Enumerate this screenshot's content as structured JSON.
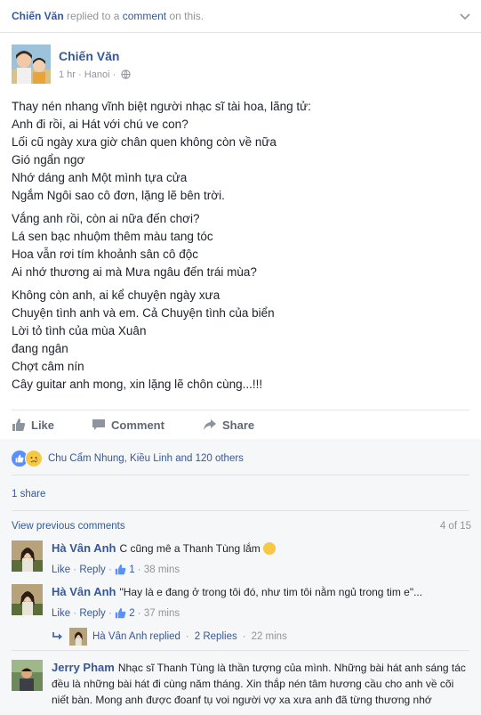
{
  "story": {
    "actor": "Chiến Văn",
    "action": "replied to a",
    "object": "comment",
    "suffix": "on this."
  },
  "post": {
    "author": "Chiến Văn",
    "time": "1 hr",
    "location": "Hanoi",
    "stanzas": [
      [
        "Thay nén nhang vĩnh biệt người nhạc sĩ tài hoa, lãng tử:",
        "Anh đi rồi, ai Hát với chú ve con?",
        "Lối cũ ngày xưa giờ chân quen không còn về nữa",
        "Gió ngẩn ngơ",
        "Nhớ dáng anh Một mình tựa cửa",
        "Ngắm Ngôi sao cô đơn, lặng lẽ bên trời."
      ],
      [
        "Vắng anh rồi, còn ai nữa đến chơi?",
        "Lá sen bạc nhuộm thêm màu tang tóc",
        "Hoa vẫn rơi tím khoảnh sân cô độc",
        "Ai nhớ thương ai mà Mưa ngâu đến trái mùa?"
      ],
      [
        "Không còn anh, ai kể chuyện ngày xưa",
        "Chuyện tình anh và em. Cả Chuyện tình của biển",
        "Lời tỏ tình của mùa Xuân",
        "đang ngân",
        "Chợt câm nín",
        "Cây guitar anh mong, xin lặng lẽ chôn cùng...!!!"
      ]
    ]
  },
  "actions": {
    "like": "Like",
    "comment": "Comment",
    "share": "Share"
  },
  "feedback": {
    "reactions_text": "Chu Cẩm Nhung, Kiều Linh and 120 others",
    "shares_text": "1 share",
    "view_previous": "View previous comments",
    "count": "4 of 15"
  },
  "comments": [
    {
      "author": "Hà Vân Anh",
      "text": "C cũng mê a Thanh Tùng lắm",
      "like": "Like",
      "reply": "Reply",
      "likes": "1",
      "time": "38 mins"
    },
    {
      "author": "Hà Vân Anh",
      "text": "\"Hay là e đang ở trong tôi đó, như tim tôi nằm ngủ trong tim e\"...",
      "like": "Like",
      "reply": "Reply",
      "likes": "2",
      "time": "37 mins"
    },
    {
      "author": "Jerry Pham",
      "text": "Nhạc sĩ Thanh Tùng là thần tượng của mình. Những bài hát anh sáng tác đều là những bài hát đi cùng năm tháng. Xin thắp nén tâm hương cầu cho anh về cõi niết bàn. Mong anh được đoanf tụ voi người vợ xa xưa anh đã từng thương nhớ"
    }
  ],
  "replies_summary": {
    "author": "Hà Vân Anh",
    "replied": "replied",
    "count": "2 Replies",
    "time": "22 mins"
  },
  "colors": {
    "link": "#365899",
    "muted": "#90949c",
    "like_blue": "#5890ff",
    "feedback_bg": "#f6f7f9"
  }
}
